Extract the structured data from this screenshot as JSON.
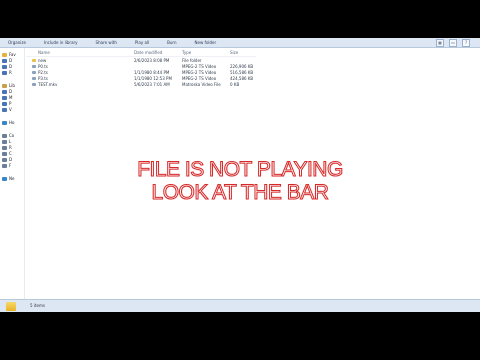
{
  "toolbar": {
    "buttons": [
      "Organize",
      "Include in library",
      "Share with",
      "Play all",
      "Burn",
      "New folder"
    ]
  },
  "sidebar": {
    "items": [
      {
        "label": "Fav",
        "color": "#e2b43c"
      },
      {
        "label": "D",
        "color": "#4a74b8"
      },
      {
        "label": "D",
        "color": "#4a74b8"
      },
      {
        "label": "R",
        "color": "#4a74b8"
      },
      {
        "label": "Lib",
        "color": "#c7a24a"
      },
      {
        "label": "D",
        "color": "#4a74b8"
      },
      {
        "label": "M",
        "color": "#4a74b8"
      },
      {
        "label": "P",
        "color": "#4a74b8"
      },
      {
        "label": "V",
        "color": "#4a74b8"
      },
      {
        "label": "Ho",
        "color": "#3a87c8"
      },
      {
        "label": "Co",
        "color": "#6a7f99"
      },
      {
        "label": "L",
        "color": "#6a7f99"
      },
      {
        "label": "R",
        "color": "#6a7f99"
      },
      {
        "label": "C",
        "color": "#6a7f99"
      },
      {
        "label": "D",
        "color": "#6a7f99"
      },
      {
        "label": "F",
        "color": "#6a7f99"
      },
      {
        "label": "Ne",
        "color": "#3a87c8"
      }
    ]
  },
  "columns": {
    "name": "Name",
    "date": "Date modified",
    "type": "Type",
    "size": "Size"
  },
  "files": [
    {
      "name": "new",
      "date": "2/6/2023 8:08 PM",
      "type": "File folder",
      "size": "",
      "color": "#e8c24a"
    },
    {
      "name": "P0.ts",
      "date": "",
      "type": "MPEG-2 TS Video",
      "size": "226,906 KB",
      "color": "#8aa0bc"
    },
    {
      "name": "P2.ts",
      "date": "1/1/1980 8:44 PM",
      "type": "MPEG-2 TS Video",
      "size": "516,586 KB",
      "color": "#8aa0bc"
    },
    {
      "name": "P3.ts",
      "date": "1/1/1980 12:53 PM",
      "type": "MPEG-2 TS Video",
      "size": "424,586 KB",
      "color": "#8aa0bc"
    },
    {
      "name": "TEST.mkv",
      "date": "5/6/2023 7:01 AM",
      "type": "Matroska Video File",
      "size": "0 KB",
      "color": "#8aa0bc"
    }
  ],
  "status": {
    "text": "5 items"
  },
  "overlay": {
    "line1": "FILE IS NOT PLAYING",
    "line2": "LOOK AT THE BAR"
  }
}
